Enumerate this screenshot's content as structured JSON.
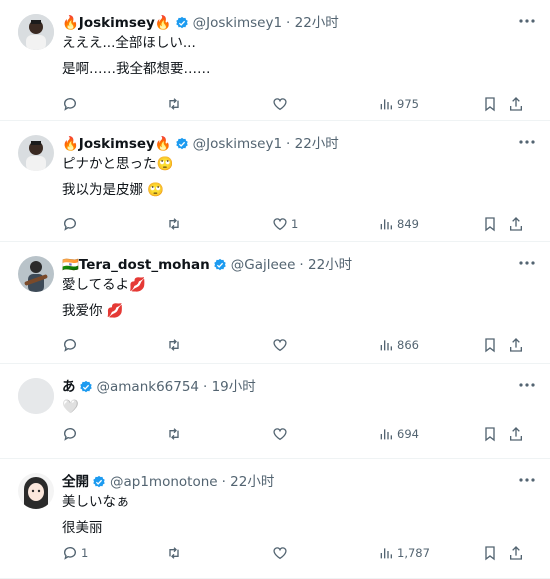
{
  "tweets": [
    {
      "name": "🔥Joskimsey🔥",
      "handle": "@Joskimsey1",
      "time": "· 22小时",
      "text": "えええ...全部ほしい...",
      "translation": "是啊……我全都想要……",
      "reply_count": "",
      "like_count": "",
      "views": "975",
      "avatar": "photo-person"
    },
    {
      "name": "🔥Joskimsey🔥",
      "handle": "@Joskimsey1",
      "time": "· 22小时",
      "text": "ピナかと思った🙄",
      "translation": "我以为是皮娜 🙄",
      "reply_count": "",
      "like_count": "1",
      "views": "849",
      "avatar": "photo-person"
    },
    {
      "name": "🇮🇳Tera_dost_mohan",
      "handle": "@Gajleee",
      "time": "· 22小时",
      "text": "愛してるよ💋",
      "translation": "我爱你 💋",
      "reply_count": "",
      "like_count": "",
      "views": "866",
      "avatar": "photo-guitar"
    },
    {
      "name": "あ",
      "handle": "@amank66754",
      "time": "· 19小时",
      "text": "🤍",
      "translation": "",
      "reply_count": "",
      "like_count": "",
      "views": "694",
      "avatar": "blank"
    },
    {
      "name": "全開",
      "handle": "@ap1monotone",
      "time": "· 22小时",
      "text": "美しいなぁ",
      "translation": "很美丽",
      "reply_count": "1",
      "like_count": "",
      "views": "1,787",
      "avatar": "cartoon-girl"
    }
  ],
  "colors": {
    "verified": "#1d9bf0",
    "muted": "#536471",
    "divider": "#eff3f4"
  },
  "icons": [
    "reply-icon",
    "retweet-icon",
    "like-icon",
    "views-icon",
    "bookmark-icon",
    "share-icon",
    "more-icon",
    "verified-badge-icon"
  ]
}
